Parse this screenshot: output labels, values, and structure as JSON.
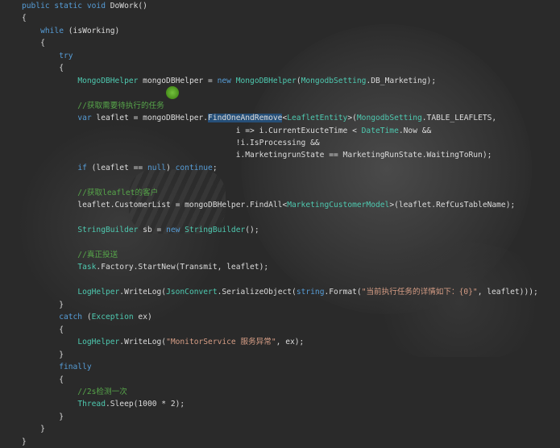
{
  "editor": {
    "lines": [
      [
        {
          "t": "public static void ",
          "c": "kw"
        },
        {
          "t": "DoWork()",
          "c": "pl"
        }
      ],
      [
        {
          "t": "{",
          "c": "pl"
        }
      ],
      [
        {
          "t": "    while ",
          "c": "kw"
        },
        {
          "t": "(isWorking)",
          "c": "pl"
        }
      ],
      [
        {
          "t": "    {",
          "c": "pl"
        }
      ],
      [
        {
          "t": "        try",
          "c": "kw"
        }
      ],
      [
        {
          "t": "        {",
          "c": "pl"
        }
      ],
      [
        {
          "t": "            ",
          "c": "pl"
        },
        {
          "t": "MongoDBHelper",
          "c": "ty"
        },
        {
          "t": " mongoDBHelper = ",
          "c": "pl"
        },
        {
          "t": "new ",
          "c": "kw"
        },
        {
          "t": "MongoDBHelper",
          "c": "ty"
        },
        {
          "t": "(",
          "c": "pl"
        },
        {
          "t": "MongodbSetting",
          "c": "ty"
        },
        {
          "t": ".DB_Marketing);",
          "c": "pl"
        }
      ],
      [],
      [
        {
          "t": "            //获取需要待执行的任务",
          "c": "cm"
        }
      ],
      [
        {
          "t": "            ",
          "c": "pl"
        },
        {
          "t": "var ",
          "c": "kw"
        },
        {
          "t": "leaflet = mongoDBHelper.",
          "c": "pl"
        },
        {
          "t": "FindOneAndRemove",
          "c": "sel"
        },
        {
          "t": "<",
          "c": "pl"
        },
        {
          "t": "LeafletEntity",
          "c": "ty"
        },
        {
          "t": ">(",
          "c": "pl"
        },
        {
          "t": "MongodbSetting",
          "c": "ty"
        },
        {
          "t": ".TABLE_LEAFLETS,",
          "c": "pl"
        }
      ],
      [
        {
          "t": "                                              i => i.CurrentExucteTime < ",
          "c": "pl"
        },
        {
          "t": "DateTime",
          "c": "ty"
        },
        {
          "t": ".Now &&",
          "c": "pl"
        }
      ],
      [
        {
          "t": "                                              !i.IsProcessing &&",
          "c": "pl"
        }
      ],
      [
        {
          "t": "                                              i.MarketingrunState == MarketingRunState.WaitingToRun);",
          "c": "pl"
        }
      ],
      [
        {
          "t": "            ",
          "c": "pl"
        },
        {
          "t": "if ",
          "c": "kw"
        },
        {
          "t": "(leaflet == ",
          "c": "pl"
        },
        {
          "t": "null",
          "c": "kw"
        },
        {
          "t": ") ",
          "c": "pl"
        },
        {
          "t": "continue",
          "c": "kw"
        },
        {
          "t": ";",
          "c": "pl"
        }
      ],
      [],
      [
        {
          "t": "            //获取leaflet的客户",
          "c": "cm"
        }
      ],
      [
        {
          "t": "            leaflet.CustomerList = mongoDBHelper.FindAll<",
          "c": "pl"
        },
        {
          "t": "MarketingCustomerModel",
          "c": "ty"
        },
        {
          "t": ">(leaflet.RefCusTableName);",
          "c": "pl"
        }
      ],
      [],
      [
        {
          "t": "            ",
          "c": "pl"
        },
        {
          "t": "StringBuilder",
          "c": "ty"
        },
        {
          "t": " sb = ",
          "c": "pl"
        },
        {
          "t": "new ",
          "c": "kw"
        },
        {
          "t": "StringBuilder",
          "c": "ty"
        },
        {
          "t": "();",
          "c": "pl"
        }
      ],
      [],
      [
        {
          "t": "            //真正投送",
          "c": "cm"
        }
      ],
      [
        {
          "t": "            ",
          "c": "pl"
        },
        {
          "t": "Task",
          "c": "ty"
        },
        {
          "t": ".Factory.StartNew(Transmit, leaflet);",
          "c": "pl"
        }
      ],
      [],
      [
        {
          "t": "            ",
          "c": "pl"
        },
        {
          "t": "LogHelper",
          "c": "ty"
        },
        {
          "t": ".WriteLog(",
          "c": "pl"
        },
        {
          "t": "JsonConvert",
          "c": "ty"
        },
        {
          "t": ".SerializeObject(",
          "c": "pl"
        },
        {
          "t": "string",
          "c": "kw"
        },
        {
          "t": ".Format(",
          "c": "pl"
        },
        {
          "t": "\"当前执行任务的详情如下：{0}\"",
          "c": "st"
        },
        {
          "t": ", leaflet)));",
          "c": "pl"
        }
      ],
      [
        {
          "t": "        }",
          "c": "pl"
        }
      ],
      [
        {
          "t": "        catch ",
          "c": "kw"
        },
        {
          "t": "(",
          "c": "pl"
        },
        {
          "t": "Exception",
          "c": "ty"
        },
        {
          "t": " ex)",
          "c": "pl"
        }
      ],
      [
        {
          "t": "        {",
          "c": "pl"
        }
      ],
      [
        {
          "t": "            ",
          "c": "pl"
        },
        {
          "t": "LogHelper",
          "c": "ty"
        },
        {
          "t": ".WriteLog(",
          "c": "pl"
        },
        {
          "t": "\"MonitorService 服务异常\"",
          "c": "st"
        },
        {
          "t": ", ex);",
          "c": "pl"
        }
      ],
      [
        {
          "t": "        }",
          "c": "pl"
        }
      ],
      [
        {
          "t": "        finally",
          "c": "kw"
        }
      ],
      [
        {
          "t": "        {",
          "c": "pl"
        }
      ],
      [
        {
          "t": "            //2s检测一次",
          "c": "cm"
        }
      ],
      [
        {
          "t": "            ",
          "c": "pl"
        },
        {
          "t": "Thread",
          "c": "ty"
        },
        {
          "t": ".Sleep(1000 * 2);",
          "c": "pl"
        }
      ],
      [
        {
          "t": "        }",
          "c": "pl"
        }
      ],
      [
        {
          "t": "    }",
          "c": "pl"
        }
      ],
      [
        {
          "t": "}",
          "c": "pl"
        }
      ]
    ]
  }
}
